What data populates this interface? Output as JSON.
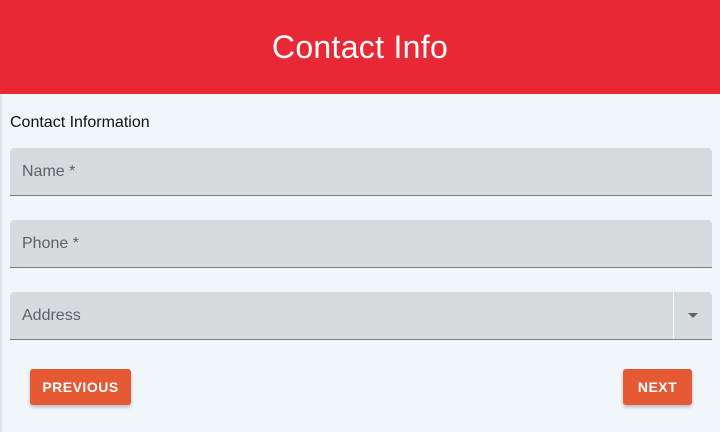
{
  "header": {
    "title": "Contact Info"
  },
  "form": {
    "section_title": "Contact Information",
    "fields": {
      "name": {
        "label": "Name *",
        "value": ""
      },
      "phone": {
        "label": "Phone *",
        "value": ""
      },
      "address": {
        "label": "Address",
        "value": "",
        "icon": "chevron-down-icon"
      }
    }
  },
  "buttons": {
    "previous": "PREVIOUS",
    "next": "NEXT"
  },
  "colors": {
    "header": "#e92835",
    "button": "#e55a34",
    "field_background": "#d7dbde",
    "page_background": "#f1f6fa"
  }
}
